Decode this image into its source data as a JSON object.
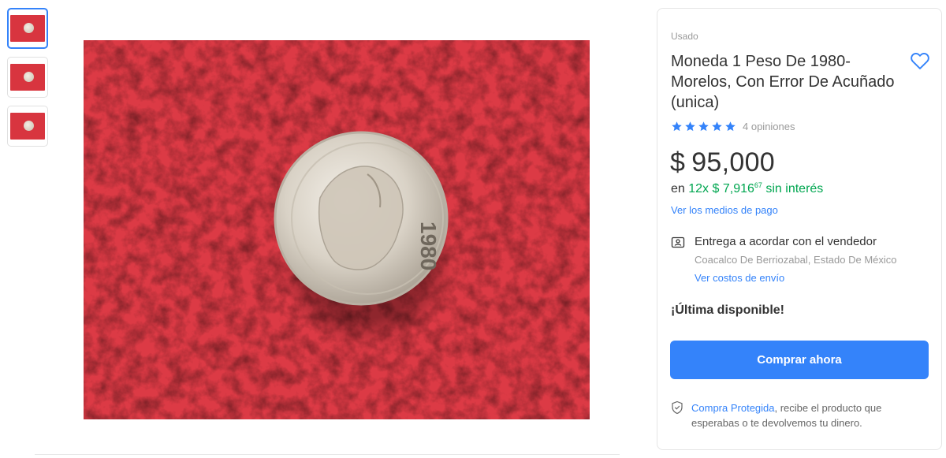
{
  "thumbnails": [
    {
      "alt": "coin-photo-1",
      "selected": true
    },
    {
      "alt": "coin-photo-2",
      "selected": false
    },
    {
      "alt": "coin-photo-3",
      "selected": false
    }
  ],
  "main_image": {
    "coin_year": "1980"
  },
  "product": {
    "condition": "Usado",
    "title": "Moneda 1 Peso De 1980- Morelos, Con Error De Acuñado (unica)",
    "rating": {
      "stars": 5,
      "opinions_text": "4 opiniones"
    },
    "price": {
      "currency": "$",
      "amount": "95,000"
    },
    "installments": {
      "prefix": "en",
      "count": "12x",
      "currency": "$",
      "amount": "7,916",
      "cents": "67",
      "suffix": "sin interés"
    },
    "payment_link": "Ver los medios de pago"
  },
  "delivery": {
    "title": "Entrega a acordar con el vendedor",
    "location": "Coacalco De Berriozabal, Estado De México",
    "shipping_link": "Ver costos de envío"
  },
  "stock": {
    "label": "¡Última disponible!"
  },
  "buy_button": {
    "label": "Comprar ahora"
  },
  "protection": {
    "link": "Compra Protegida",
    "text": ", recibe el producto que esperabas o te devolvemos tu dinero."
  },
  "colors": {
    "accent": "#3483fa",
    "green": "#00a650",
    "star": "#3483fa",
    "muted": "#999999"
  },
  "icons": {
    "favorite": "heart-outline-icon",
    "star": "star-icon",
    "delivery": "person-card-icon",
    "protection": "shield-check-icon"
  }
}
